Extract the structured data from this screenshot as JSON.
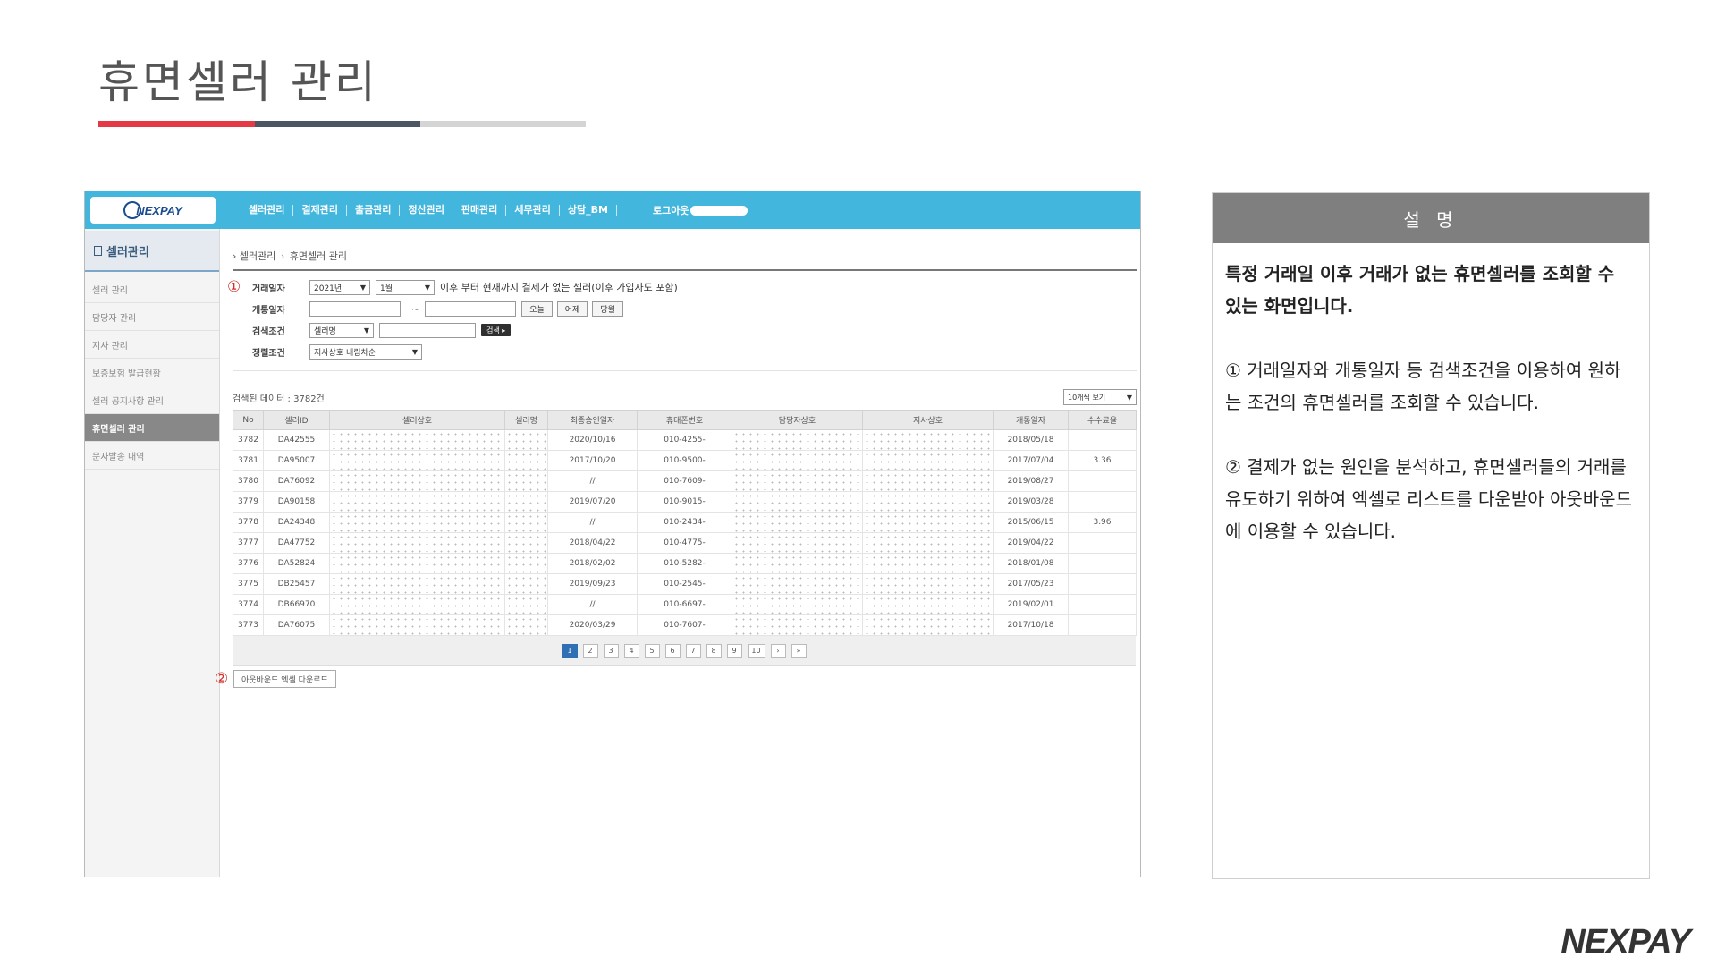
{
  "slide": {
    "title": "휴면셀러 관리",
    "brand": "NEXPAY"
  },
  "app": {
    "logo_text": "NEXPAY",
    "nav": [
      "셀러관리",
      "결제관리",
      "출금관리",
      "정산관리",
      "판매관리",
      "세무관리",
      "상담_BM"
    ],
    "login_label": "로그아웃",
    "sidebar": {
      "title": "셀러관리",
      "items": [
        "셀러 관리",
        "담당자 관리",
        "지사 관리",
        "보증보험 발급현황",
        "셀러 공지사항 관리",
        "휴면셀러 관리",
        "문자발송 내역"
      ],
      "active_index": 5
    },
    "breadcrumb": {
      "root": "셀러관리",
      "current": "휴면셀러 관리"
    },
    "search": {
      "row1": {
        "label": "거래일자",
        "year": "2021년",
        "month": "1월",
        "description": "이후 부터 현재까지 결제가 없는 셀러(이후 가입자도 포함)"
      },
      "row2": {
        "label": "개통일자",
        "tilde": "~",
        "btn_today": "오늘",
        "btn_yesterday": "어제",
        "btn_month": "당월"
      },
      "row3": {
        "label": "검색조건",
        "select": "셀러명",
        "search_btn": "검색 ▸"
      },
      "row4": {
        "label": "정렬조건",
        "select": "지사상호 내림차순"
      }
    },
    "markers": {
      "one": "①",
      "two": "②"
    },
    "result_count": "검색된 데이터 : 3782건",
    "rows_per_page": "10개씩 보기",
    "table": {
      "headers": [
        "No",
        "셀러ID",
        "셀러상호",
        "셀러명",
        "최종승인일자",
        "휴대폰번호",
        "담당자상호",
        "지사상호",
        "개통일자",
        "수수료율"
      ],
      "rows": [
        [
          "3782",
          "DA42555",
          "",
          "",
          "2020/10/16",
          "010-4255-",
          "",
          "",
          "2018/05/18",
          ""
        ],
        [
          "3781",
          "DA95007",
          "",
          "",
          "2017/10/20",
          "010-9500-",
          "",
          "",
          "2017/07/04",
          "3.36"
        ],
        [
          "3780",
          "DA76092",
          "",
          "",
          "//",
          "010-7609-",
          "",
          "",
          "2019/08/27",
          ""
        ],
        [
          "3779",
          "DA90158",
          "",
          "",
          "2019/07/20",
          "010-9015-",
          "",
          "",
          "2019/03/28",
          ""
        ],
        [
          "3778",
          "DA24348",
          "",
          "",
          "//",
          "010-2434-",
          "",
          "",
          "2015/06/15",
          "3.96"
        ],
        [
          "3777",
          "DA47752",
          "",
          "",
          "2018/04/22",
          "010-4775-",
          "",
          "",
          "2019/04/22",
          ""
        ],
        [
          "3776",
          "DA52824",
          "",
          "",
          "2018/02/02",
          "010-5282-",
          "",
          "",
          "2018/01/08",
          ""
        ],
        [
          "3775",
          "DB25457",
          "",
          "",
          "2019/09/23",
          "010-2545-",
          "",
          "",
          "2017/05/23",
          ""
        ],
        [
          "3774",
          "DB66970",
          "",
          "",
          "//",
          "010-6697-",
          "",
          "",
          "2019/02/01",
          ""
        ],
        [
          "3773",
          "DA76075",
          "",
          "",
          "2020/03/29",
          "010-7607-",
          "",
          "",
          "2017/10/18",
          ""
        ]
      ]
    },
    "pager": {
      "pages": [
        "1",
        "2",
        "3",
        "4",
        "5",
        "6",
        "7",
        "8",
        "9",
        "10"
      ],
      "next": "›",
      "last": "»"
    },
    "download_btn": "아웃바운드 엑셀 다운로드"
  },
  "description": {
    "header": "설 명",
    "lead": "특정 거래일 이후 거래가 없는 휴면셀러를 조회할 수 있는 화면입니다.",
    "p1": "① 거래일자와 개통일자 등 검색조건을 이용하여 원하는 조건의 휴면셀러를 조회할 수 있습니다.",
    "p2": "② 결제가 없는 원인을 분석하고, 휴면셀러들의 거래를 유도하기 위하여 엑셀로 리스트를 다운받아 아웃바운드에 이용할 수 있습니다."
  }
}
